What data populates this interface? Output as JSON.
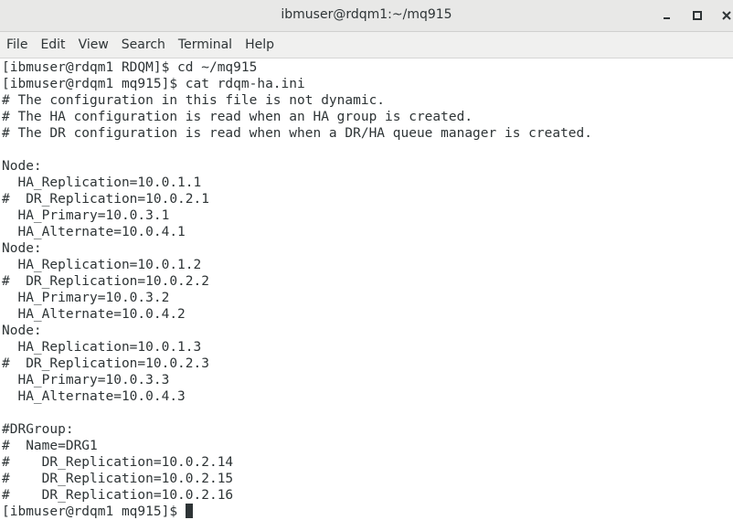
{
  "window": {
    "title": "ibmuser@rdqm1:~/mq915"
  },
  "menu": {
    "items": [
      "File",
      "Edit",
      "View",
      "Search",
      "Terminal",
      "Help"
    ]
  },
  "terminal": {
    "lines": [
      "[ibmuser@rdqm1 RDQM]$ cd ~/mq915",
      "[ibmuser@rdqm1 mq915]$ cat rdqm-ha.ini",
      "# The configuration in this file is not dynamic.",
      "# The HA configuration is read when an HA group is created.",
      "# The DR configuration is read when when a DR/HA queue manager is created.",
      "",
      "Node:",
      "  HA_Replication=10.0.1.1",
      "#  DR_Replication=10.0.2.1",
      "  HA_Primary=10.0.3.1",
      "  HA_Alternate=10.0.4.1",
      "Node:",
      "  HA_Replication=10.0.1.2",
      "#  DR_Replication=10.0.2.2",
      "  HA_Primary=10.0.3.2",
      "  HA_Alternate=10.0.4.2",
      "Node:",
      "  HA_Replication=10.0.1.3",
      "#  DR_Replication=10.0.2.3",
      "  HA_Primary=10.0.3.3",
      "  HA_Alternate=10.0.4.3",
      "",
      "#DRGroup:",
      "#  Name=DRG1",
      "#    DR_Replication=10.0.2.14",
      "#    DR_Replication=10.0.2.15",
      "#    DR_Replication=10.0.2.16"
    ],
    "prompt": "[ibmuser@rdqm1 mq915]$ "
  },
  "colors": {
    "text": "#2e3436",
    "titlebar": "#e8e8e7",
    "menubar": "#f0f0ef",
    "background": "#ffffff"
  }
}
